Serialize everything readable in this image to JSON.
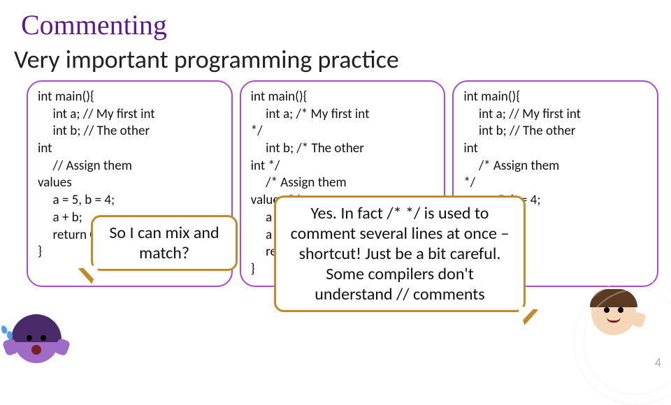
{
  "title": "Commenting",
  "subtitle": "Very important programming practice",
  "code": {
    "col1": "int main(){\n     int a; // My first int\n     int b; // The other\nint\n     // Assign them\nvalues\n     a = 5, b = 4;\n     a + b;\n     return 0;\n}",
    "col2": "int main(){\n     int a; /* My first int\n*/\n     int b; /* The other\nint */\n     /* Assign them\nvalues */\n     a = 5, b = 4;\n     a + b;\n     return 0;\n}",
    "col3": "int main(){\n     int a; // My first int\n     int b; // The other\nint\n     /* Assign them\n*/\n     a = 5, b = 4;\n     a + b;\n     return 0;\n}"
  },
  "speech": {
    "left": "So I can mix and match?",
    "right": "Yes. In fact /* */ is used to comment several lines at once – shortcut!\nJust be a bit careful. Some compilers don't understand // comments"
  },
  "pagenum": "4"
}
